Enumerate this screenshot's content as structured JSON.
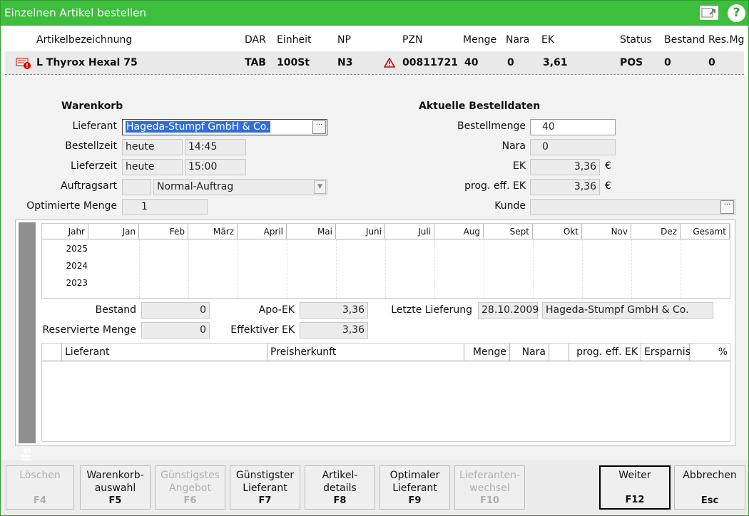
{
  "window": {
    "title": "Einzelnen Artikel bestellen",
    "help": "?"
  },
  "header": {
    "cols": [
      "Artikelbezeichnung",
      "DAR",
      "Einheit",
      "NP",
      "PZN",
      "Menge",
      "Nara",
      "EK",
      "Status",
      "Bestand",
      "Res.Mg"
    ]
  },
  "article": {
    "name": "L Thyrox Hexal 75",
    "dar": "TAB",
    "einheit": "100St",
    "np": "N3",
    "pzn": "00811721",
    "menge": "40",
    "nara": "0",
    "ek": "3,61",
    "status": "POS",
    "bestand": "0",
    "resmg": "0"
  },
  "warenkorb": {
    "title": "Warenkorb",
    "lieferant_label": "Lieferant",
    "lieferant_value": "Hageda-Stumpf GmbH & Co.",
    "bestellzeit_label": "Bestellzeit",
    "bestellzeit_day": "heute",
    "bestellzeit_time": "14:45",
    "lieferzeit_label": "Lieferzeit",
    "lieferzeit_day": "heute",
    "lieferzeit_time": "15:00",
    "auftragsart_label": "Auftragsart",
    "auftragsart_value": "Normal-Auftrag",
    "optmenge_label": "Optimierte Menge",
    "optmenge_value": "1"
  },
  "bestelldaten": {
    "title": "Aktuelle Bestelldaten",
    "bestellmenge_label": "Bestellmenge",
    "bestellmenge_value": "40",
    "nara_label": "Nara",
    "nara_value": "0",
    "ek_label": "EK",
    "ek_value": "3,36",
    "ek_unit": "€",
    "progek_label": "prog. eff. EK",
    "progek_value": "3,36",
    "progek_unit": "€",
    "kunde_label": "Kunde",
    "kunde_value": ""
  },
  "details": {
    "tab": "Details",
    "grid_headers": [
      "Jahr",
      "Jan",
      "Feb",
      "März",
      "April",
      "Mai",
      "Juni",
      "Juli",
      "Aug",
      "Sept",
      "Okt",
      "Nov",
      "Dez",
      "Gesamt"
    ],
    "years": [
      "2025",
      "2024",
      "2023"
    ],
    "bestand_label": "Bestand",
    "bestand_value": "0",
    "resmenge_label": "Reservierte Menge",
    "resmenge_value": "0",
    "apoek_label": "Apo-EK",
    "apoek_value": "3,36",
    "effek_label": "Effektiver EK",
    "effek_value": "3,36",
    "letzte_label": "Letzte Lieferung",
    "letzte_date": "28.10.2009",
    "letzte_supplier": "Hageda-Stumpf GmbH & Co.",
    "table_headers": [
      "Lieferant",
      "Preisherkunft",
      "Menge",
      "Nara",
      "prog. eff. EK",
      "Ersparnis",
      "%"
    ]
  },
  "footer": [
    {
      "label": "Löschen",
      "key": "F4",
      "disabled": true
    },
    {
      "label": "Warenkorb-\nauswahl",
      "key": "F5",
      "disabled": false
    },
    {
      "label": "Günstigstes\nAngebot",
      "key": "F6",
      "disabled": true
    },
    {
      "label": "Günstigster\nLieferant",
      "key": "F7",
      "disabled": false
    },
    {
      "label": "Artikel-\ndetails",
      "key": "F8",
      "disabled": false
    },
    {
      "label": "Optimaler\nLieferant",
      "key": "F9",
      "disabled": false
    },
    {
      "label": "Lieferanten-\nwechsel",
      "key": "F10",
      "disabled": true
    },
    {
      "label": "Weiter",
      "key": "F12",
      "disabled": false
    },
    {
      "label": "Abbrechen",
      "key": "Esc",
      "disabled": false
    }
  ]
}
